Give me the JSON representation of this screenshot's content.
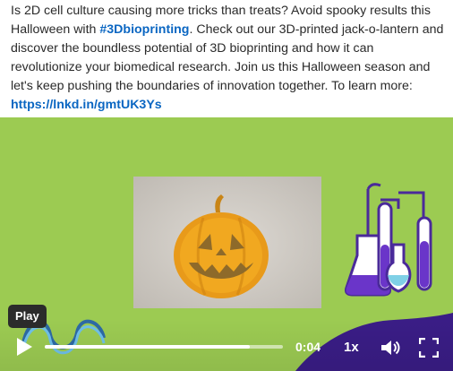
{
  "post": {
    "text_1": "Is 2D cell culture causing more tricks than treats? Avoid spooky results this Halloween with ",
    "hashtag": "#3Dbioprinting",
    "text_2": ". Check out our 3D-printed jack-o-lantern and discover the boundless potential of 3D bioprinting and how it can revolutionize your biomedical research. Join us this Halloween season and let's keep pushing the boundaries of innovation together. To learn more: ",
    "link": "https://lnkd.in/gmtUK3Ys"
  },
  "video": {
    "tooltip": "Play",
    "time": "0:04",
    "speed": "1x",
    "progress": 0.86,
    "colors": {
      "background": "#9ccb52",
      "accent_purple": "#3a1d86",
      "pumpkin": "#f0a21b"
    }
  },
  "icons": {
    "play": "play-icon",
    "volume": "volume-icon",
    "fullscreen": "fullscreen-icon"
  }
}
